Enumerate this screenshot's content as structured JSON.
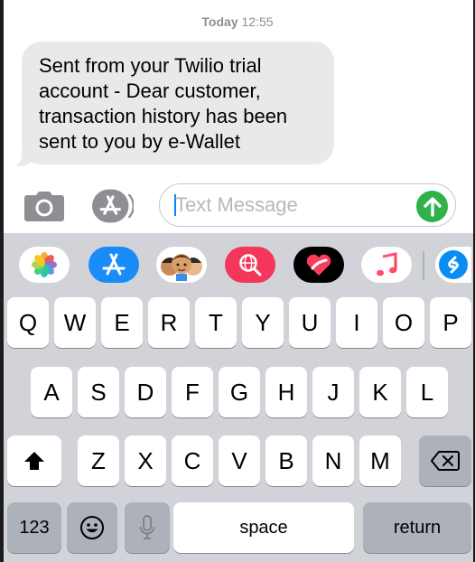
{
  "conversation": {
    "timestamp_day": "Today",
    "timestamp_time": "12:55",
    "message_lines": [
      "Sent from your Twilio trial",
      "account - Dear customer,",
      "transaction history has been",
      "sent to you by e-Wallet"
    ]
  },
  "input_bar": {
    "camera_icon": "camera-icon",
    "appstore_icon": "appstore-icon",
    "placeholder": "Text Message",
    "value": "",
    "send_icon": "arrow-up-icon",
    "send_color": "#2fb24a"
  },
  "app_drawer": {
    "apps": [
      "photos",
      "app-store",
      "memoji",
      "web-search",
      "digital-touch",
      "music",
      "shazam"
    ]
  },
  "keyboard": {
    "row1": [
      "Q",
      "W",
      "E",
      "R",
      "T",
      "Y",
      "U",
      "I",
      "O",
      "P"
    ],
    "row2": [
      "A",
      "S",
      "D",
      "F",
      "G",
      "H",
      "J",
      "K",
      "L"
    ],
    "row3": [
      "Z",
      "X",
      "C",
      "V",
      "B",
      "N",
      "M"
    ],
    "shift_icon": "shift-icon",
    "delete_icon": "delete-icon",
    "numbers_label": "123",
    "emoji_icon": "emoji-icon",
    "mic_icon": "microphone-icon",
    "space_label": "space",
    "return_label": "return"
  }
}
